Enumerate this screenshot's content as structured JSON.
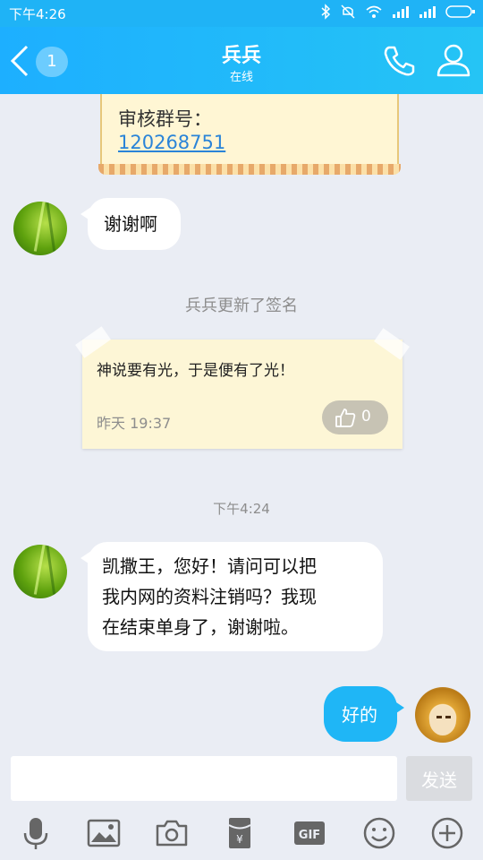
{
  "status_bar": {
    "time": "下午4:26"
  },
  "header": {
    "unread_count": "1",
    "contact_name": "兵兵",
    "contact_status": "在线"
  },
  "group_card": {
    "label": "审核群号：",
    "number": "120268751"
  },
  "messages": [
    {
      "from": "contact",
      "text": "谢谢啊"
    }
  ],
  "signature_update": {
    "notice": "兵兵更新了签名",
    "text": "神说要有光，于是便有了光！",
    "time": "昨天 19:37",
    "likes": "0"
  },
  "timestamp": "下午4:24",
  "message2": {
    "line1": "凯撒王，您好！请问可以把",
    "line2": "我内网的资料注销吗？我现",
    "line3": "在结束单身了，谢谢啦。"
  },
  "reply": "好的",
  "input": {
    "send_label": "发送"
  },
  "colors": {
    "accent": "#1fb6f6",
    "header": "#1dafff",
    "background": "#eaedf4"
  },
  "toolbar_icons": [
    "microphone-icon",
    "image-icon",
    "camera-icon",
    "red-packet-icon",
    "gif-icon",
    "emoji-icon",
    "plus-icon"
  ]
}
